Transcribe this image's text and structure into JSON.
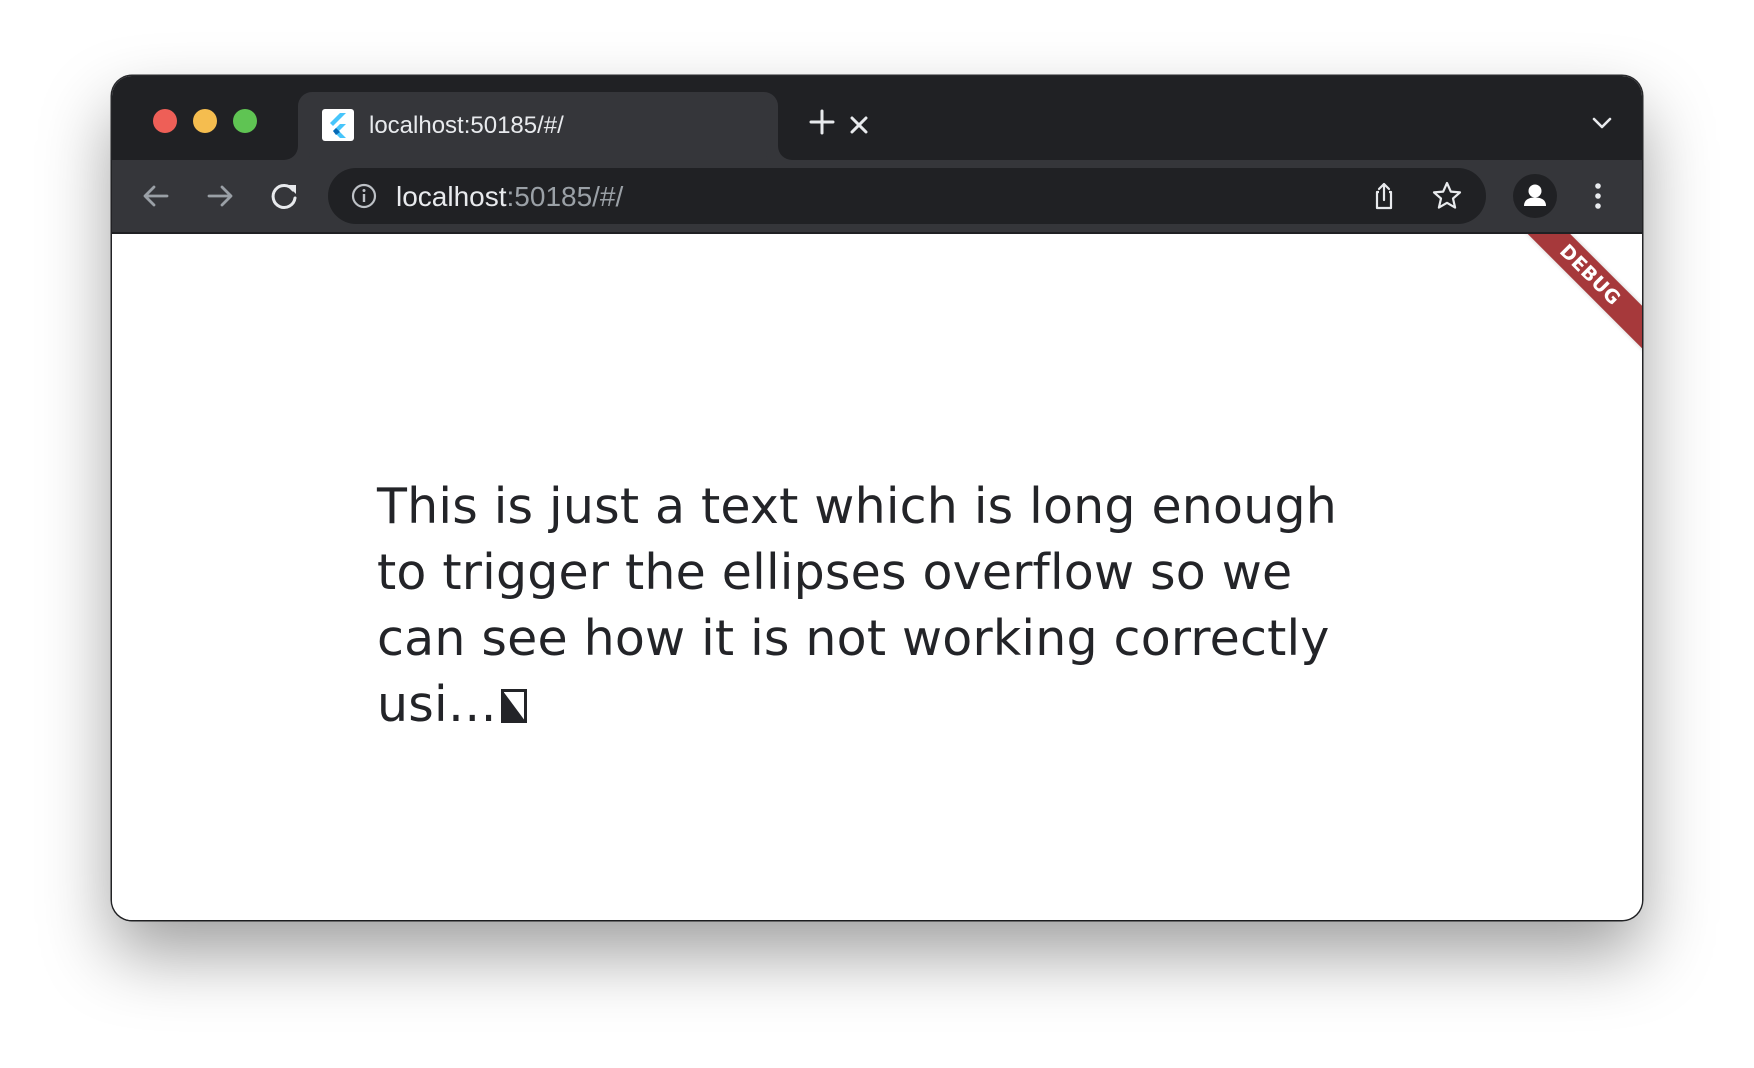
{
  "browser": {
    "tab": {
      "title": "localhost:50185/#/",
      "favicon": "flutter-logo-icon"
    },
    "address_bar": {
      "host": "localhost",
      "rest": ":50185/#/"
    },
    "icons": {
      "close_tab": "close-icon",
      "new_tab": "plus-icon",
      "tab_search": "chevron-down-icon",
      "back": "arrow-left-icon",
      "forward": "arrow-right-icon",
      "reload": "reload-icon",
      "site_info": "info-icon",
      "share": "share-icon",
      "bookmark": "star-icon",
      "profile": "person-icon",
      "menu": "kebab-menu-icon"
    },
    "colors": {
      "tab_strip": "#202124",
      "toolbar": "#35363a",
      "traffic_close": "#ee5f57",
      "traffic_minimize": "#f5bd4f",
      "traffic_maximize": "#5fc453"
    }
  },
  "page": {
    "message": "This is just a text which is long enough to trigger the ellipses overflow so we can see how it is not working correctly usi…",
    "debug_banner": "DEBUG",
    "debug_banner_color": "#a6393b"
  }
}
